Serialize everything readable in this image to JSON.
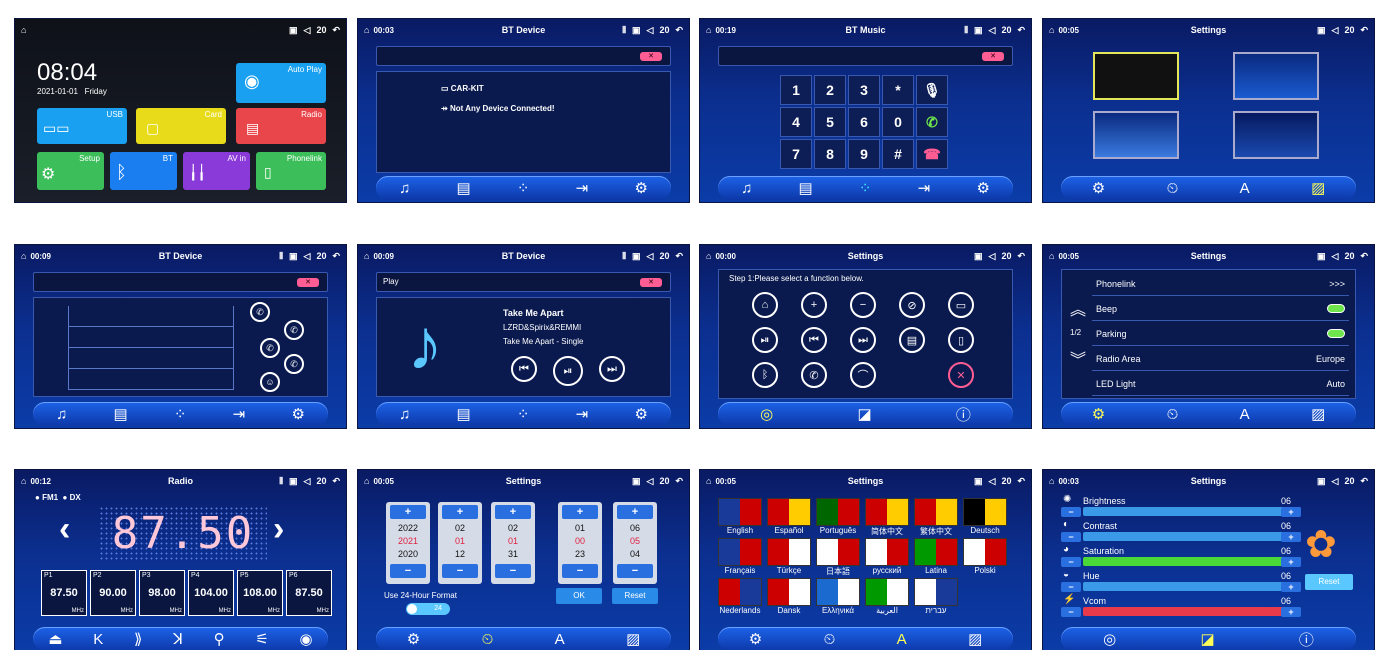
{
  "colors": {
    "accent": "#1d63e8",
    "pink": "#ff5d93",
    "green": "#6ee54c"
  },
  "s1": {
    "time": "08:04",
    "date": "2021-01-01",
    "day": "Friday",
    "vol": "20",
    "tiles": {
      "autoplay": "Auto Play",
      "usb": "USB",
      "card": "Card",
      "radio": "Radio",
      "setup": "Setup",
      "bt": "BT",
      "avin": "AV in",
      "phonelink": "Phonelink"
    }
  },
  "s2": {
    "clock": "00:03",
    "title": "BT Device",
    "vol": "20",
    "device": "CAR-KIT",
    "status": "Not Any Device Connected!"
  },
  "s3": {
    "clock": "00:19",
    "title": "BT Music",
    "vol": "20",
    "keys": [
      "1",
      "2",
      "3",
      "*",
      "4",
      "5",
      "6",
      "0",
      "7",
      "8",
      "9",
      "#"
    ]
  },
  "s4": {
    "clock": "00:05",
    "title": "Settings",
    "vol": "20"
  },
  "s5": {
    "clock": "00:09",
    "title": "BT Device",
    "vol": "20"
  },
  "s6": {
    "clock": "00:09",
    "title": "BT Device",
    "vol": "20",
    "field": "Play",
    "song": "Take Me Apart",
    "artist": "LZRD&Spirix&REMMI",
    "album": "Take Me Apart - Single"
  },
  "s7": {
    "clock": "00:00",
    "title": "Settings",
    "vol": "20",
    "step": "Step 1:Please select a function below."
  },
  "s8": {
    "clock": "00:05",
    "title": "Settings",
    "vol": "20",
    "page": "1/2",
    "rows": [
      {
        "label": "Phonelink",
        "value": ">>>"
      },
      {
        "label": "Beep",
        "value": ""
      },
      {
        "label": "Parking",
        "value": ""
      },
      {
        "label": "Radio Area",
        "value": "Europe"
      },
      {
        "label": "LED Light",
        "value": "Auto"
      }
    ]
  },
  "s9": {
    "clock": "00:12",
    "title": "Radio",
    "vol": "20",
    "band": "FM1",
    "dx": "DX",
    "freq": "87.50",
    "presets": [
      {
        "n": "P1",
        "v": "87.50"
      },
      {
        "n": "P2",
        "v": "90.00"
      },
      {
        "n": "P3",
        "v": "98.00"
      },
      {
        "n": "P4",
        "v": "104.00"
      },
      {
        "n": "P5",
        "v": "108.00"
      },
      {
        "n": "P6",
        "v": "87.50"
      }
    ],
    "unit": "MHz"
  },
  "s10": {
    "clock": "00:05",
    "title": "Settings",
    "vol": "20",
    "spinners": [
      [
        "2022",
        "2021",
        "2020"
      ],
      [
        "02",
        "01",
        "12"
      ],
      [
        "02",
        "01",
        "31"
      ],
      [
        "01",
        "00",
        "23"
      ],
      [
        "06",
        "05",
        "04"
      ]
    ],
    "fmt": "Use 24-Hour Format",
    "fmtval": "24",
    "ok": "OK",
    "reset": "Reset"
  },
  "s11": {
    "clock": "00:05",
    "title": "Settings",
    "vol": "20",
    "langs": [
      "English",
      "Español",
      "Português",
      "简体中文",
      "繁体中文",
      "Deutsch",
      "Français",
      "Türkçe",
      "日本語",
      "русский",
      "Latina",
      "Polski",
      "Nederlands",
      "Dansk",
      "Ελληνικά",
      "العربية",
      "עברית"
    ]
  },
  "s12": {
    "clock": "00:03",
    "title": "Settings",
    "vol": "20",
    "rows": [
      {
        "label": "Brightness",
        "value": "06"
      },
      {
        "label": "Contrast",
        "value": "06"
      },
      {
        "label": "Saturation",
        "value": "06"
      },
      {
        "label": "Hue",
        "value": "06"
      },
      {
        "label": "Vcom",
        "value": "06"
      }
    ],
    "reset": "Reset"
  }
}
